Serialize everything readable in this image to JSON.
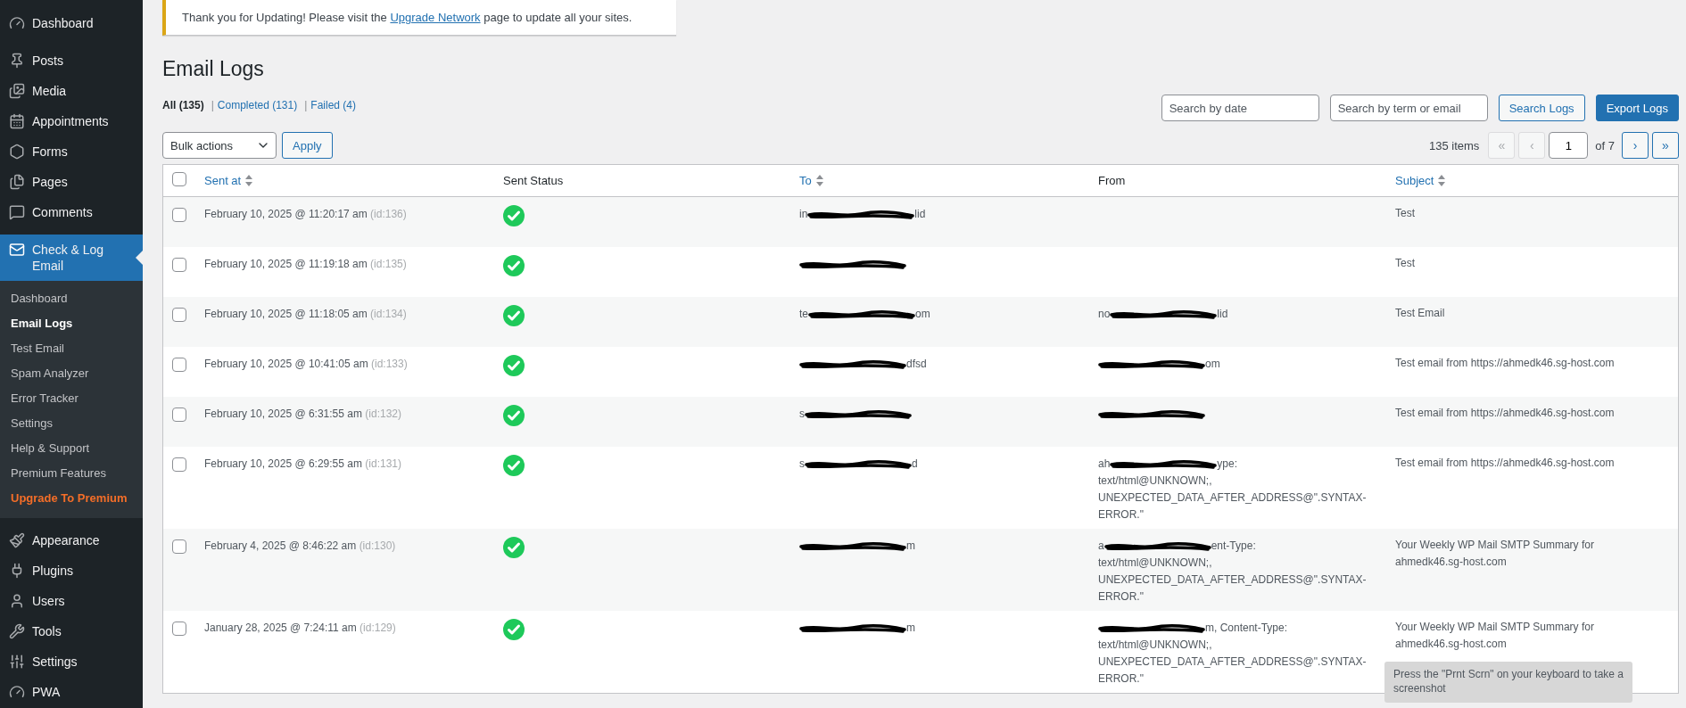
{
  "sidebar": {
    "items": [
      {
        "label": "Dashboard",
        "selected": false
      },
      {
        "label": "Posts",
        "selected": false
      },
      {
        "label": "Media",
        "selected": false
      },
      {
        "label": "Appointments",
        "selected": false
      },
      {
        "label": "Forms",
        "selected": false
      },
      {
        "label": "Pages",
        "selected": false
      },
      {
        "label": "Comments",
        "selected": false
      },
      {
        "label": "Check & Log Email",
        "selected": true,
        "children": [
          {
            "label": "Dashboard",
            "selected": false,
            "kind": "link"
          },
          {
            "label": "Email Logs",
            "selected": true,
            "kind": "link"
          },
          {
            "label": "Test Email",
            "selected": false,
            "kind": "link"
          },
          {
            "label": "Spam Analyzer",
            "selected": false,
            "kind": "link"
          },
          {
            "label": "Error Tracker",
            "selected": false,
            "kind": "link"
          },
          {
            "label": "Settings",
            "selected": false,
            "kind": "link"
          },
          {
            "label": "Help & Support",
            "selected": false,
            "kind": "link"
          },
          {
            "label": "Premium Features",
            "selected": false,
            "kind": "link"
          },
          {
            "label": "Upgrade To Premium",
            "selected": false,
            "kind": "upgrade"
          }
        ]
      },
      {
        "label": "Appearance",
        "selected": false
      },
      {
        "label": "Plugins",
        "selected": false
      },
      {
        "label": "Users",
        "selected": false
      },
      {
        "label": "Tools",
        "selected": false
      },
      {
        "label": "Settings",
        "selected": false
      },
      {
        "label": "PWA",
        "selected": false
      }
    ]
  },
  "notice": {
    "before": "Thank you for Updating! Please visit the",
    "link": "Upgrade Network",
    "after": "page to update all your sites."
  },
  "page_title": "Email Logs",
  "filters": [
    {
      "label": "All (135)",
      "selected": true
    },
    {
      "separator": "|",
      "label": "Completed (131)",
      "selected": false
    },
    {
      "separator": "|",
      "label": "Failed (4)",
      "selected": false
    }
  ],
  "search": {
    "date_placeholder": "Search by date",
    "term_placeholder": "Search by term or email",
    "search_button": "Search Logs",
    "export_button": "Export Logs"
  },
  "bulk": {
    "select": "Bulk actions",
    "apply": "Apply"
  },
  "pagination": {
    "count": "135 items",
    "first": {
      "label": "«",
      "disabled": true
    },
    "prev": {
      "label": "‹",
      "disabled": true
    },
    "page": "1",
    "of": "of 7",
    "next": {
      "label": "›",
      "disabled": false
    },
    "last": {
      "label": "»",
      "disabled": false
    }
  },
  "table": {
    "select_all_checked": false,
    "columns": [
      {
        "label": "Sent at",
        "sortable": true
      },
      {
        "label": "Sent Status",
        "sortable": false
      },
      {
        "label": "To",
        "sortable": true
      },
      {
        "label": "From",
        "sortable": false
      },
      {
        "label": "Subject",
        "sortable": true
      }
    ],
    "rows": [
      {
        "checked": false,
        "sent_at": "February 10, 2025 @ 11:20:17 am",
        "id": "(id:136)",
        "delivered": true,
        "to": [
          {
            "kind": "text",
            "text": "in"
          },
          {
            "kind": "redaction"
          },
          {
            "kind": "text",
            "text": "lid"
          }
        ],
        "from": [],
        "subject": "Test"
      },
      {
        "checked": false,
        "sent_at": "February 10, 2025 @ 11:19:18 am",
        "id": "(id:135)",
        "delivered": true,
        "to": [
          {
            "kind": "redaction"
          }
        ],
        "from": [],
        "subject": "Test"
      },
      {
        "checked": false,
        "sent_at": "February 10, 2025 @ 11:18:05 am",
        "id": "(id:134)",
        "delivered": true,
        "to": [
          {
            "kind": "text",
            "text": "te"
          },
          {
            "kind": "redaction"
          },
          {
            "kind": "text",
            "text": "om"
          }
        ],
        "from": [
          {
            "kind": "text",
            "text": "no"
          },
          {
            "kind": "redaction"
          },
          {
            "kind": "text",
            "text": "lid"
          }
        ],
        "subject": "Test Email"
      },
      {
        "checked": false,
        "sent_at": "February 10, 2025 @ 10:41:05 am",
        "id": "(id:133)",
        "delivered": true,
        "to": [
          {
            "kind": "redaction"
          },
          {
            "kind": "text",
            "text": "dfsd"
          }
        ],
        "from": [
          {
            "kind": "redaction"
          },
          {
            "kind": "text",
            "text": "om"
          }
        ],
        "subject": "Test email from https://ahmedk46.sg-host.com"
      },
      {
        "checked": false,
        "sent_at": "February 10, 2025 @ 6:31:55 am",
        "id": "(id:132)",
        "delivered": true,
        "to": [
          {
            "kind": "text",
            "text": "s"
          },
          {
            "kind": "redaction"
          }
        ],
        "from": [
          {
            "kind": "redaction"
          }
        ],
        "subject": "Test email from https://ahmedk46.sg-host.com"
      },
      {
        "checked": false,
        "sent_at": "February 10, 2025 @ 6:29:55 am",
        "id": "(id:131)",
        "delivered": true,
        "to": [
          {
            "kind": "text",
            "text": "s"
          },
          {
            "kind": "redaction"
          },
          {
            "kind": "text",
            "text": "d"
          }
        ],
        "from": [
          {
            "kind": "text",
            "text": "ah"
          },
          {
            "kind": "redaction"
          },
          {
            "kind": "text",
            "text": "ype:"
          },
          {
            "kind": "block",
            "text": "text/html@UNKNOWN;, UNEXPECTED_DATA_AFTER_ADDRESS@\".SYNTAX-ERROR.\""
          }
        ],
        "subject": "Test email from https://ahmedk46.sg-host.com"
      },
      {
        "checked": false,
        "sent_at": "February 4, 2025 @ 8:46:22 am",
        "id": "(id:130)",
        "delivered": true,
        "to": [
          {
            "kind": "redaction"
          },
          {
            "kind": "text",
            "text": "m"
          }
        ],
        "from": [
          {
            "kind": "text",
            "text": "a"
          },
          {
            "kind": "redaction"
          },
          {
            "kind": "text",
            "text": "ent-Type:"
          },
          {
            "kind": "block",
            "text": "text/html@UNKNOWN;, UNEXPECTED_DATA_AFTER_ADDRESS@\".SYNTAX-ERROR.\""
          }
        ],
        "subject": "Your Weekly WP Mail SMTP Summary for ahmedk46.sg-host.com"
      },
      {
        "checked": false,
        "sent_at": "January 28, 2025 @ 7:24:11 am",
        "id": "(id:129)",
        "delivered": true,
        "to": [
          {
            "kind": "redaction"
          },
          {
            "kind": "text",
            "text": "m"
          }
        ],
        "from": [
          {
            "kind": "redaction"
          },
          {
            "kind": "text",
            "text": "m, Content-Type:"
          },
          {
            "kind": "block",
            "text": "text/html@UNKNOWN;, UNEXPECTED_DATA_AFTER_ADDRESS@\".SYNTAX-ERROR.\""
          }
        ],
        "subject": "Your Weekly WP Mail SMTP Summary for ahmedk46.sg-host.com"
      }
    ]
  },
  "toast": "Press the \"Prnt Scrn\" on your keyboard to take a screenshot"
}
